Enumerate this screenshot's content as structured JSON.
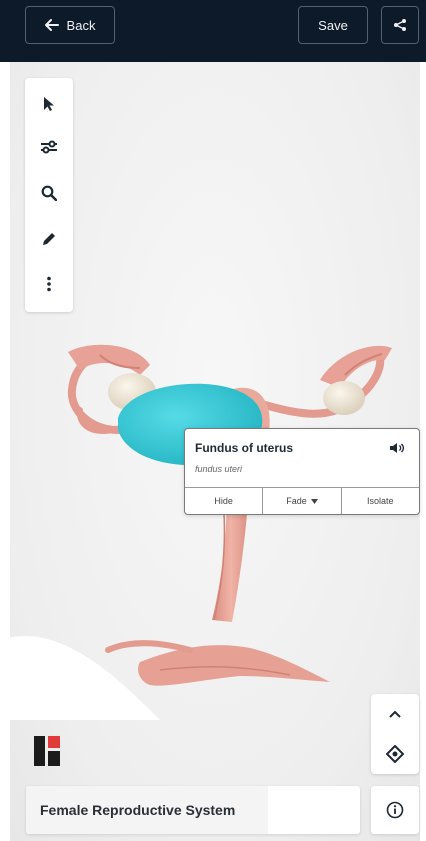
{
  "header": {
    "back_label": "Back",
    "save_label": "Save",
    "back_icon": "arrow-left-icon",
    "share_icon": "share-icon"
  },
  "toolbar": {
    "items": [
      {
        "name": "select",
        "icon": "pointer-icon"
      },
      {
        "name": "adjust",
        "icon": "sliders-icon"
      },
      {
        "name": "search",
        "icon": "search-icon"
      },
      {
        "name": "draw",
        "icon": "pencil-icon"
      },
      {
        "name": "more",
        "icon": "more-vertical-icon"
      }
    ]
  },
  "selection": {
    "title": "Fundus of uterus",
    "latin": "fundus uteri",
    "audio_icon": "speaker-icon",
    "actions": [
      {
        "label": "Hide"
      },
      {
        "label": "Fade"
      },
      {
        "label": "Isolate"
      }
    ]
  },
  "footer": {
    "model_name": "Female Reproductive System",
    "info_icon": "info-icon",
    "collapse_icon": "chevron-up-icon",
    "recenter_icon": "target-icon"
  },
  "colors": {
    "header_bg": "#0c1a29",
    "highlight": "#3bc6d4",
    "tissue": "#e8a89a",
    "ovary": "#f0e8d8"
  }
}
